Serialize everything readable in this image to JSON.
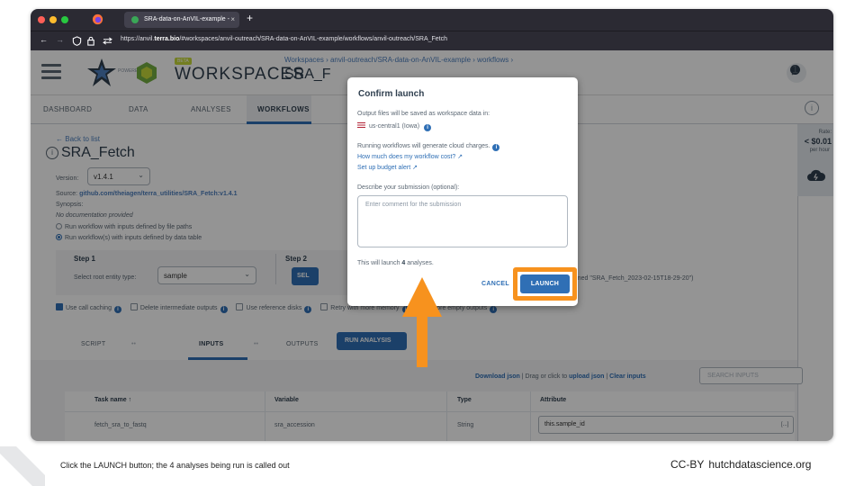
{
  "browser": {
    "tab_title": "SRA-data-on-AnVIL-example - ",
    "tab_close": "×",
    "new_tab": "+",
    "url_prefix": "https://anvil.",
    "url_domain": "terra.bio",
    "url_rest": "/#workspaces/anvil-outreach/SRA-data-on-AnVIL-example/workflows/anvil-outreach/SRA_Fetch"
  },
  "header": {
    "powered_by": "POWERED BY",
    "beta": "BETA",
    "app_title": "WORKSPACES",
    "breadcrumb": "Workspaces › anvil-outreach/SRA-data-on-AnVIL-example › workflows ›",
    "workspace_title": "SRA_F",
    "notification_count": "1"
  },
  "nav": {
    "tabs": [
      "DASHBOARD",
      "DATA",
      "ANALYSES",
      "WORKFLOWS"
    ],
    "active": "WORKFLOWS"
  },
  "cost_panel": {
    "label": "Rate:",
    "value": "< $0.01",
    "unit": "per hour"
  },
  "workflow": {
    "back_label": "Back to list",
    "title": "SRA_Fetch",
    "version_label": "Version:",
    "version": "v1.4.1",
    "source_label": "Source:",
    "source_link": "github.com/theiagen/terra_utilities/SRA_Fetch:v1.4.1",
    "synopsis_label": "Synopsis:",
    "synopsis": "No documentation provided",
    "radio_paths": "Run workflow with inputs defined by file paths",
    "radio_table": "Run workflow(s) with inputs defined by data table",
    "step1_label": "Step 1",
    "root_label": "Select root entity type:",
    "root_value": "sample",
    "step2_label": "Step 2",
    "select_button": "SEL",
    "named_text": "named \"SRA_Fetch_2023-02-15T18-29-20\")",
    "option_call_caching": "Use call caching",
    "option_delete": "Delete intermediate outputs",
    "option_reference": "Use reference disks",
    "option_retry": "Retry with more memory",
    "option_ignore": "Ignore empty outputs",
    "tab_script": "SCRIPT",
    "tab_inputs": "INPUTS",
    "tab_outputs": "OUTPUTS",
    "tab_dots": "••",
    "run_button": "RUN ANALYSIS"
  },
  "inputs_table": {
    "download": "Download json",
    "drag_text": "| Drag or click to",
    "upload": "upload json",
    "sep": "|",
    "clear": "Clear inputs",
    "search_placeholder": "SEARCH INPUTS",
    "headers": [
      "Task name ↑",
      "Variable",
      "Type",
      "Attribute"
    ],
    "row": {
      "task": "fetch_sra_to_fastq",
      "variable": "sra_accession",
      "type": "String",
      "attribute": "this.sample_id",
      "more": "[...]"
    }
  },
  "modal": {
    "title": "Confirm launch",
    "output_text": "Output files will be saved as workspace data in:",
    "region": "us-central1 (Iowa)",
    "charges_text": "Running workflows will generate cloud charges.",
    "cost_link": "How much does my workflow cost? ↗",
    "budget_link": "Set up budget alert ↗",
    "describe_label": "Describe your submission (optional):",
    "comment_placeholder": "Enter comment for the submission",
    "launch_prefix": "This will launch ",
    "launch_count": "4",
    "launch_suffix": " analyses.",
    "cancel_label": "CANCEL",
    "launch_label": "LAUNCH"
  },
  "slide": {
    "caption": "Click the LAUNCH button; the 4 analyses being run is called out",
    "license": "CC-BY",
    "site": "hutchdatascience.org"
  },
  "colors": {
    "highlight": "#f7921e",
    "primary": "#2f6fb5"
  }
}
